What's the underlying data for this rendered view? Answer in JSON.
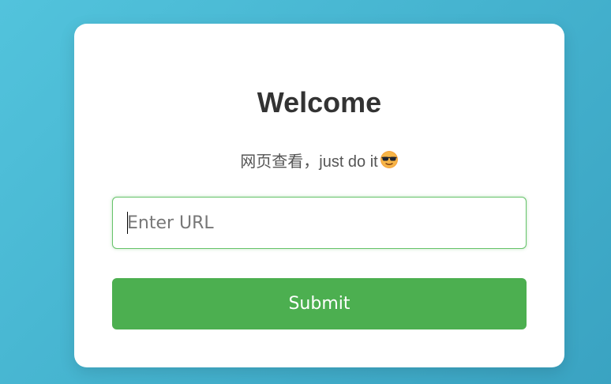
{
  "card": {
    "title": "Welcome",
    "subtitle": "网页查看，just do it",
    "subtitle_emoji": "smiling-face-with-sunglasses"
  },
  "form": {
    "url_placeholder": "Enter URL",
    "url_value": "",
    "submit_label": "Submit"
  },
  "colors": {
    "accent": "#4caf50",
    "background_gradient": [
      "#52c3dc",
      "#3aa3c2"
    ],
    "title": "#333333"
  }
}
